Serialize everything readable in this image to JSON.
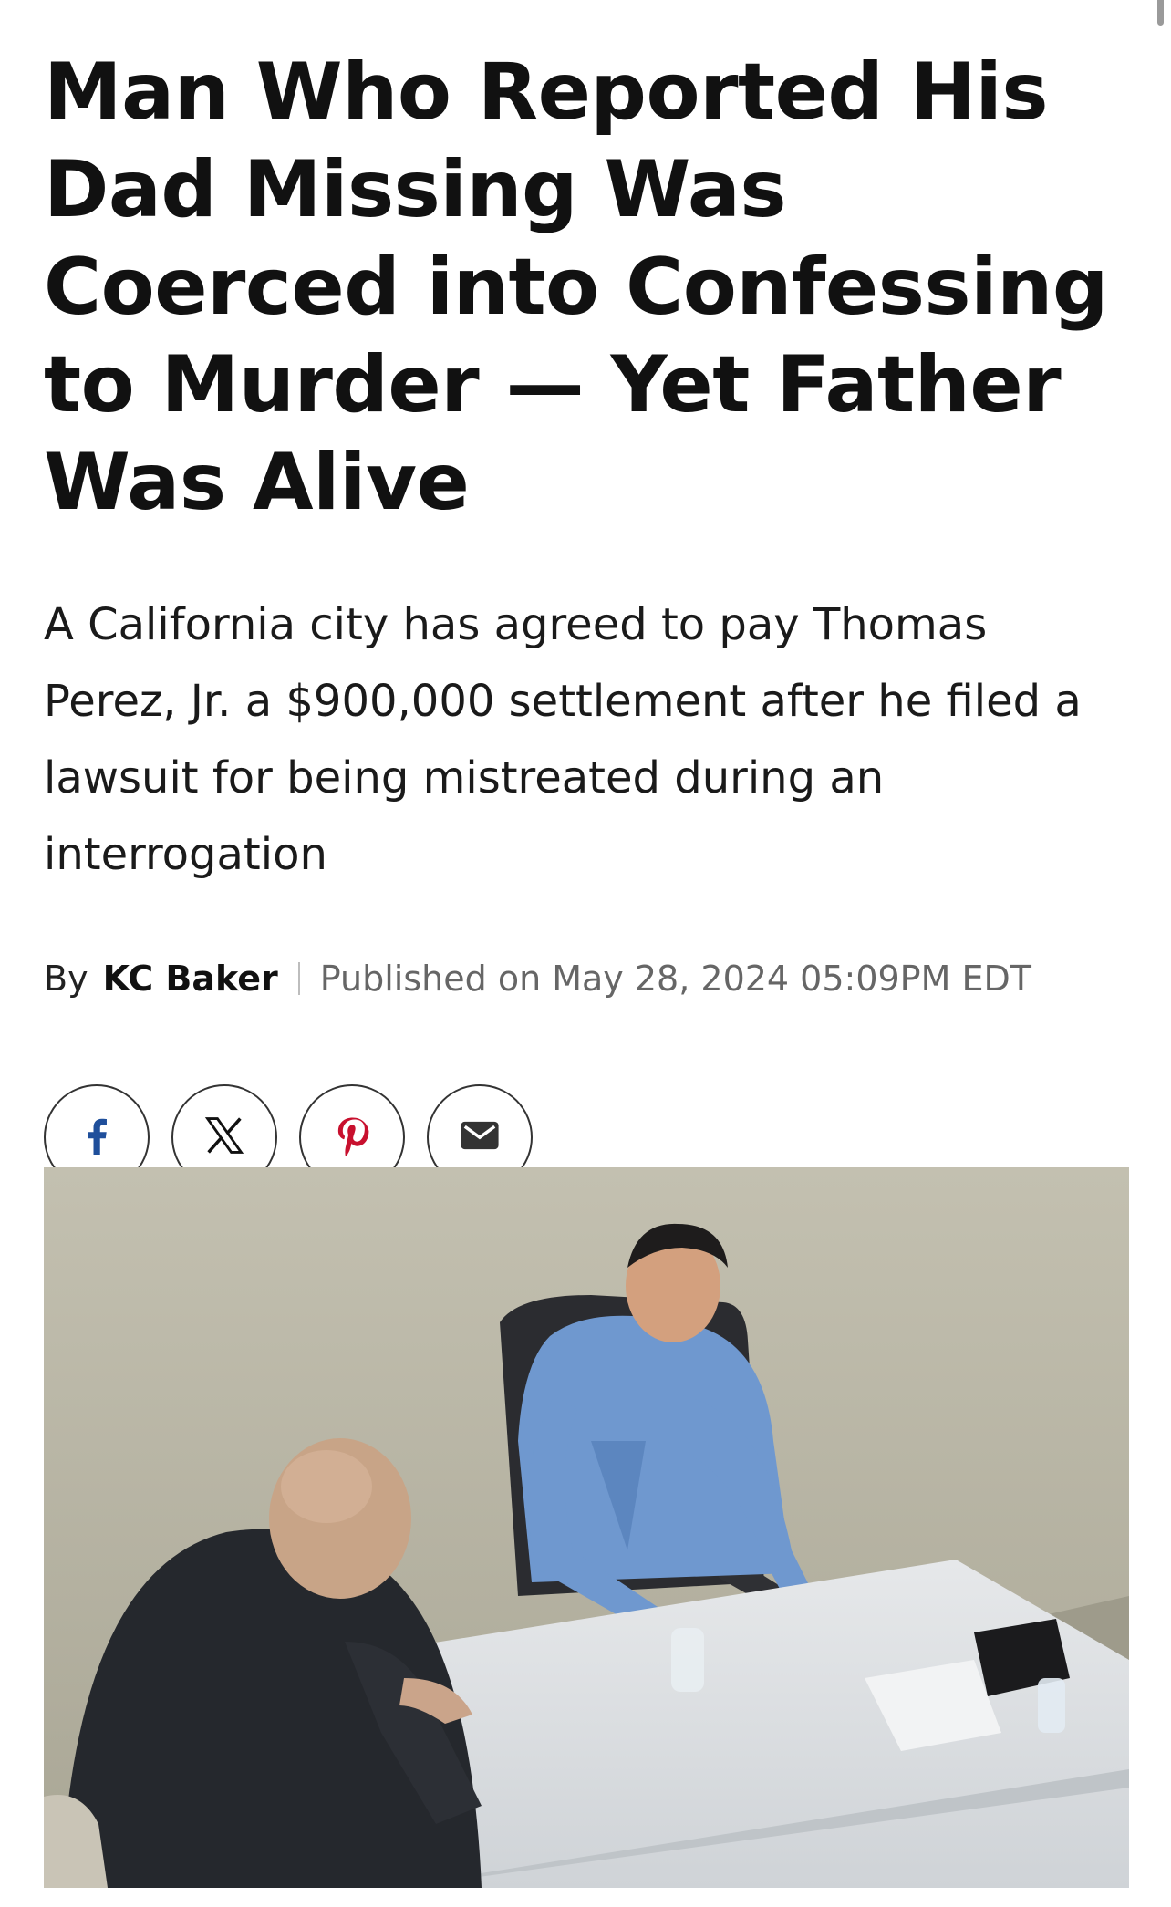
{
  "article": {
    "headline": "Man Who Reported His Dad Missing Was Coerced into Confessing to Murder — Yet Father Was Alive",
    "dek": "A California city has agreed to pay Thomas Perez, Jr. a $900,000 settlement after he filed a lawsuit for being mistreated during an interrogation",
    "byline": {
      "prefix": "By",
      "author": "KC Baker",
      "published": "Published on May 28, 2024 05:09PM EDT"
    }
  },
  "share": {
    "buttons": [
      {
        "icon": "facebook-icon",
        "color": "#1f4f9b"
      },
      {
        "icon": "x-icon",
        "color": "#111111"
      },
      {
        "icon": "pinterest-icon",
        "color": "#c8102e"
      },
      {
        "icon": "email-icon",
        "color": "#333333"
      }
    ]
  },
  "colors": {
    "text": "#111111",
    "muted": "#666666",
    "border": "#333333"
  }
}
